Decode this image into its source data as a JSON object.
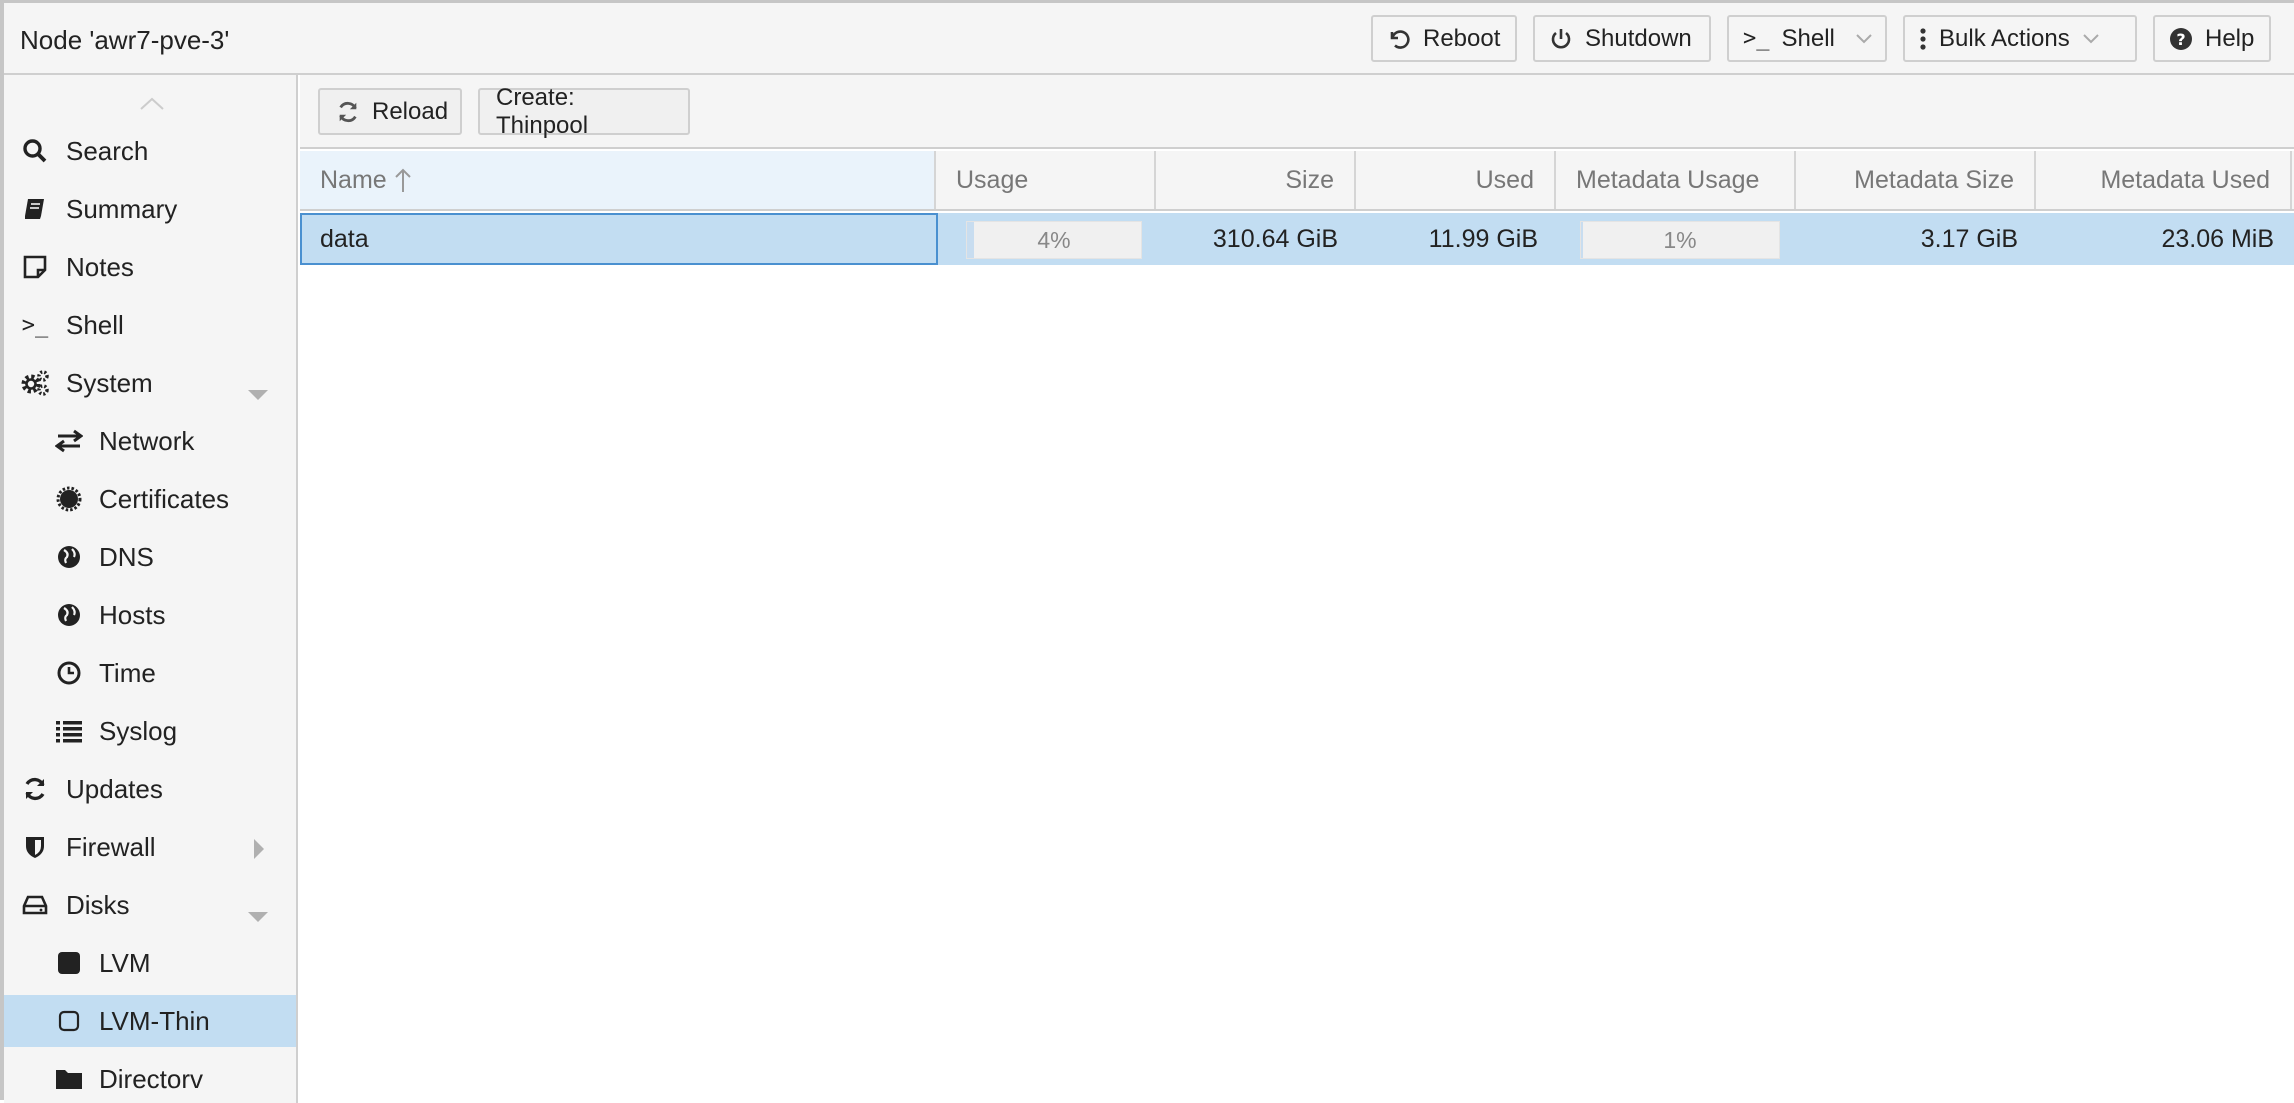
{
  "header": {
    "title": "Node 'awr7-pve-3'",
    "reboot_label": "Reboot",
    "shutdown_label": "Shutdown",
    "shell_label": "Shell",
    "bulk_label": "Bulk Actions",
    "help_label": "Help"
  },
  "sidebar": {
    "items": [
      {
        "label": "Search",
        "icon": "search-icon"
      },
      {
        "label": "Summary",
        "icon": "book-icon"
      },
      {
        "label": "Notes",
        "icon": "notes-icon"
      },
      {
        "label": "Shell",
        "icon": "terminal-icon"
      },
      {
        "label": "System",
        "icon": "cogs-icon",
        "expanded": true
      },
      {
        "label": "Network",
        "icon": "exchange-icon"
      },
      {
        "label": "Certificates",
        "icon": "certificate-icon"
      },
      {
        "label": "DNS",
        "icon": "globe-icon"
      },
      {
        "label": "Hosts",
        "icon": "globe-icon"
      },
      {
        "label": "Time",
        "icon": "clock-icon"
      },
      {
        "label": "Syslog",
        "icon": "list-icon"
      },
      {
        "label": "Updates",
        "icon": "refresh-icon"
      },
      {
        "label": "Firewall",
        "icon": "shield-icon",
        "expanded": false
      },
      {
        "label": "Disks",
        "icon": "hdd-icon",
        "expanded": true
      },
      {
        "label": "LVM",
        "icon": "square-filled-icon"
      },
      {
        "label": "LVM-Thin",
        "icon": "square-outline-icon",
        "selected": true
      },
      {
        "label": "Directorv",
        "icon": "folder-icon"
      }
    ]
  },
  "toolbar": {
    "reload_label": "Reload",
    "create_label": "Create: Thinpool"
  },
  "grid": {
    "columns": [
      "Name",
      "Usage",
      "Size",
      "Used",
      "Metadata Usage",
      "Metadata Size",
      "Metadata Used"
    ],
    "sort_column": "Name",
    "sort_direction": "ascending",
    "rows": [
      {
        "name": "data",
        "usage": "4%",
        "usage_fraction": 0.04,
        "size": "310.64 GiB",
        "used": "11.99 GiB",
        "metadata_usage": "1%",
        "metadata_usage_fraction": 0.01,
        "metadata_size": "3.17 GiB",
        "metadata_used": "23.06 MiB"
      }
    ]
  },
  "colors": {
    "selection": "#c2ddf2",
    "header_bg": "#f5f5f5",
    "border": "#cfcfcf",
    "focus": "#4a90d0"
  }
}
